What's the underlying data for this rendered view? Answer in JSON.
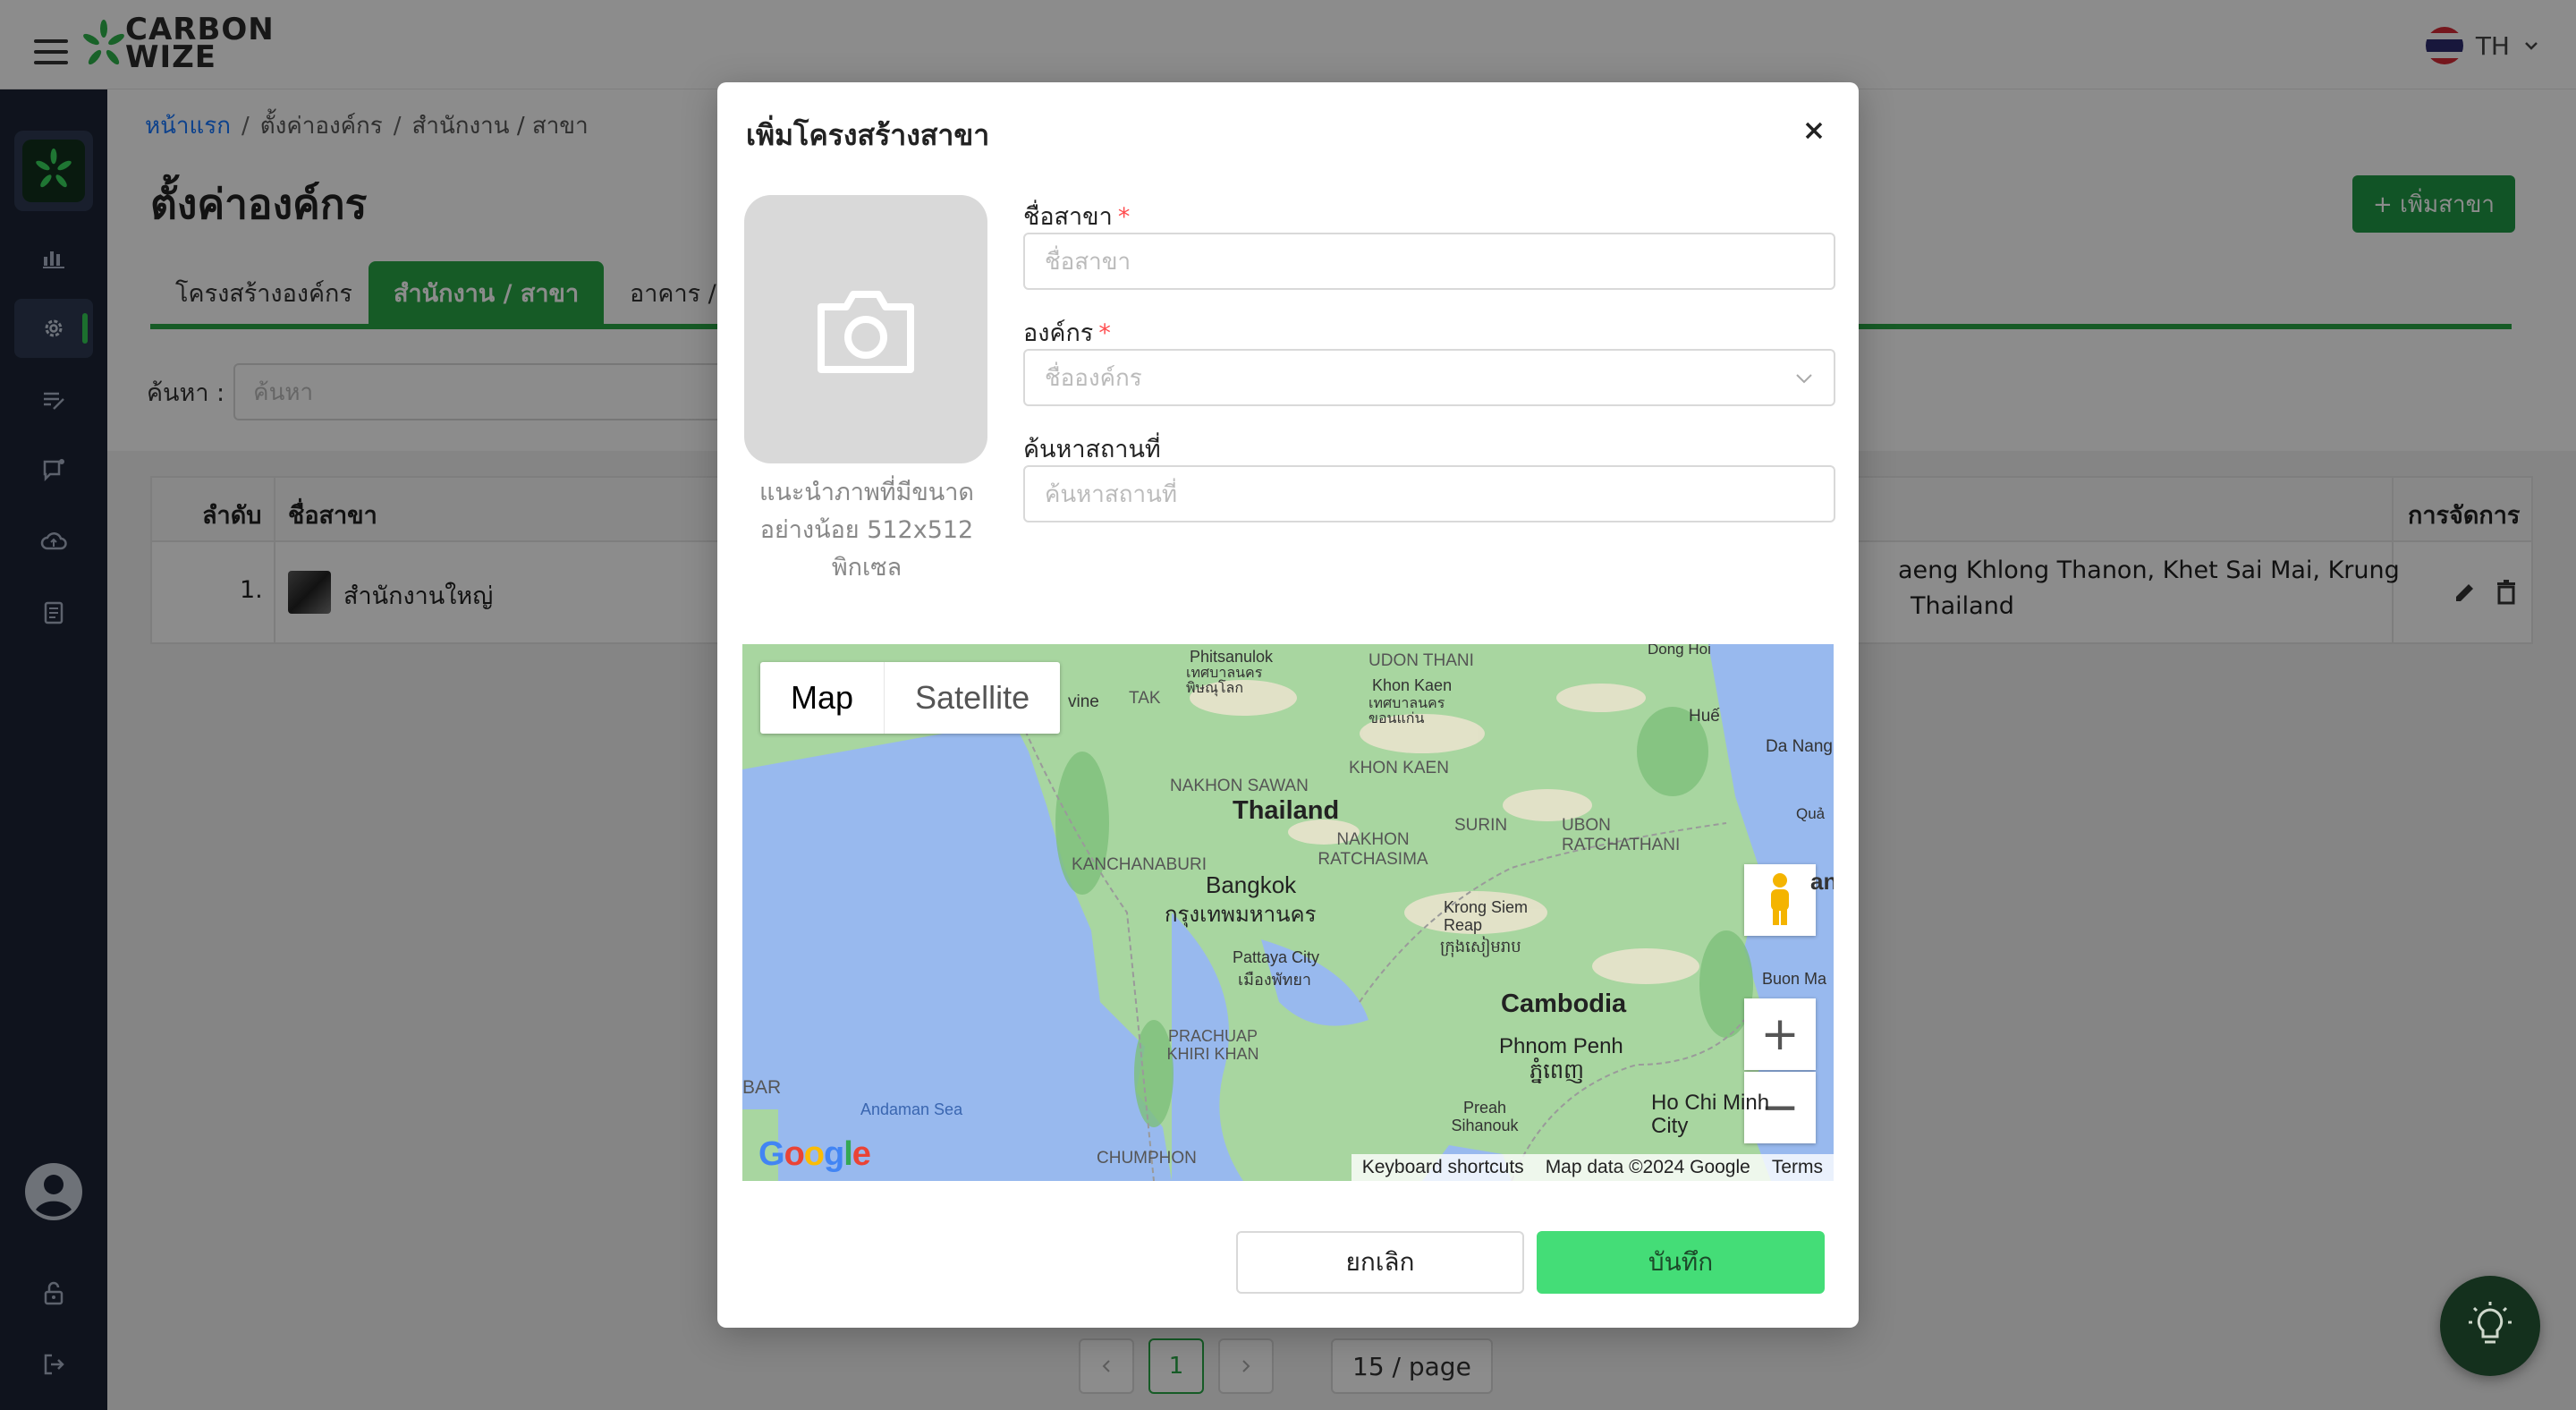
{
  "app": {
    "logo_line1": "CARBON",
    "logo_line2": "WIZE",
    "language": "TH"
  },
  "colors": {
    "brand_green": "#28a745",
    "sidebar_bg": "#1c2436",
    "save_button": "#44dd77",
    "link_blue": "#1677ff"
  },
  "sidebar": {
    "items": [
      {
        "icon": "bar-chart-icon"
      },
      {
        "icon": "gear-icon",
        "active": true
      },
      {
        "icon": "edit-list-icon"
      },
      {
        "icon": "message-icon"
      },
      {
        "icon": "cloud-upload-icon"
      },
      {
        "icon": "document-icon"
      }
    ],
    "bottom": [
      {
        "icon": "user-avatar-icon"
      },
      {
        "icon": "unlock-icon"
      },
      {
        "icon": "logout-icon"
      }
    ]
  },
  "breadcrumb": {
    "home": "หน้าแรก",
    "level2": "ตั้งค่าองค์กร",
    "level3": "สำนักงาน / สาขา"
  },
  "page": {
    "title": "ตั้งค่าองค์กร",
    "add_button": "+ เพิ่มสาขา",
    "search_label": "ค้นหา :",
    "search_placeholder": "ค้นหา"
  },
  "tabs": [
    {
      "label": "โครงสร้างองค์กร"
    },
    {
      "label": "สำนักงาน / สาขา",
      "active": true
    },
    {
      "label": "อาคาร / โร"
    }
  ],
  "table": {
    "headers": {
      "index": "ลำดับ",
      "name": "ชื่อสาขา",
      "actions": "การจัดการ"
    },
    "rows": [
      {
        "index": "1.",
        "name": "สำนักงานใหญ่",
        "address_line1": "aeng Khlong Thanon, Khet Sai Mai, Krung",
        "address_line2": "Thailand"
      }
    ]
  },
  "pagination": {
    "current": "1",
    "page_size": "15 / page"
  },
  "modal": {
    "title": "เพิ่มโครงสร้างสาขา",
    "upload_hint": "แนะนำภาพที่มีขนาดอย่างน้อย 512x512 พิกเซล",
    "branch_name_label": "ชื่อสาขา",
    "branch_name_placeholder": "ชื่อสาขา",
    "org_label": "องค์กร",
    "org_placeholder": "ชื่อองค์กร",
    "location_label": "ค้นหาสถานที่",
    "location_placeholder": "ค้นหาสถานที่",
    "cancel": "ยกเลิก",
    "save": "บันทึก",
    "required_mark": "*"
  },
  "map": {
    "type_map": "Map",
    "type_satellite": "Satellite",
    "zoom_in": "+",
    "zoom_out": "−",
    "footer_shortcuts": "Keyboard shortcuts",
    "footer_data": "Map data ©2024 Google",
    "footer_terms": "Terms",
    "google": "Google",
    "labels": {
      "phitsanulok": "Phitsanulok",
      "phitsanulok_th": "เทศบาลนคร พิษณุโลก",
      "udon": "UDON THANI",
      "khon_kaen_city": "Khon Kaen",
      "khon_kaen_th": "เทศบาลนคร ขอนแก่น",
      "hue": "Huế",
      "danang": "Da Nang",
      "tak": "TAK",
      "vine": "vine",
      "khon_kaen": "KHON KAEN",
      "nakhon_sawan": "NAKHON SAWAN",
      "thailand": "Thailand",
      "surin": "SURIN",
      "ubon": "UBON RATCHATHANI",
      "nakhon_ratchasima": "NAKHON RATCHASIMA",
      "kanchanaburi": "KANCHANABURI",
      "bangkok": "Bangkok",
      "bangkok_th": "กรุงเทพมหานคร",
      "krong_siem_reap": "Krong Siem Reap",
      "siem_reap_th": "ក្រុងសៀមរាប",
      "pattaya": "Pattaya City",
      "pattaya_th": "เมืองพัทยา",
      "cambodia": "Cambodia",
      "buon_ma": "Buon Ma",
      "phnom_penh": "Phnom Penh",
      "phnom_penh_km": "ភ្នំពេញ",
      "prachuap": "PRACHUAP KHIRI KHAN",
      "bar": "BAR",
      "andaman": "Andaman Sea",
      "ho_chi_minh": "Ho Chi Minh City",
      "preah_sihanouk": "Preah Sihanouk",
      "chumphon": "CHUMPHON",
      "dong_hoi": "Dong Hoi",
      "quan": "Quả",
      "an": "an"
    }
  }
}
